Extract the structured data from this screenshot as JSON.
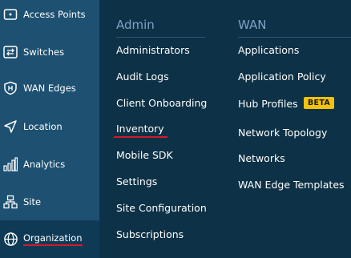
{
  "sidebar": {
    "items": [
      {
        "label": "Access Points",
        "icon": "access-points-icon"
      },
      {
        "label": "Switches",
        "icon": "switches-icon"
      },
      {
        "label": "WAN Edges",
        "icon": "wan-edges-icon"
      },
      {
        "label": "Location",
        "icon": "location-icon"
      },
      {
        "label": "Analytics",
        "icon": "analytics-icon"
      },
      {
        "label": "Site",
        "icon": "site-icon"
      },
      {
        "label": "Organization",
        "icon": "organization-icon"
      }
    ]
  },
  "menu": {
    "admin": {
      "title": "Admin",
      "items": [
        "Administrators",
        "Audit Logs",
        "Client Onboarding",
        "Inventory",
        "Mobile SDK",
        "Settings",
        "Site Configuration",
        "Subscriptions"
      ]
    },
    "wan": {
      "title": "WAN",
      "items": [
        "Applications",
        "Application Policy",
        "Hub Profiles",
        "Network Topology",
        "Networks",
        "WAN Edge Templates"
      ],
      "badge": "BETA"
    }
  },
  "colors": {
    "sidebar_bg": "#1d5071",
    "menu_bg": "#0d3146",
    "title": "#7fa3c7",
    "underline": "#d11a2a",
    "badge": "#f4c20d"
  }
}
